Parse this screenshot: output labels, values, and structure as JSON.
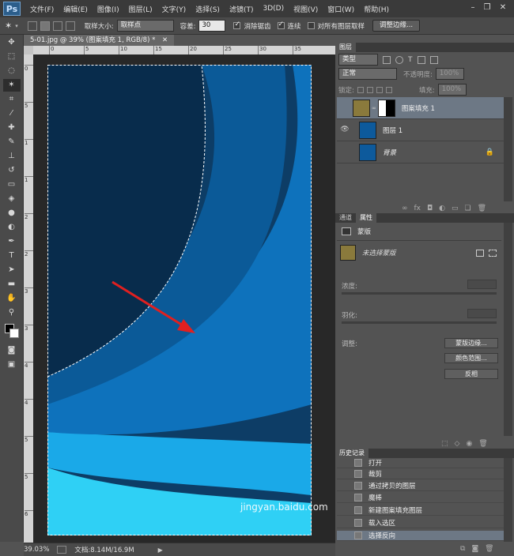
{
  "menubar": {
    "logo": "Ps",
    "items": [
      "文件(F)",
      "编辑(E)",
      "图像(I)",
      "图层(L)",
      "文字(Y)",
      "选择(S)",
      "滤镜(T)",
      "3D(D)",
      "视图(V)",
      "窗口(W)",
      "帮助(H)"
    ]
  },
  "options": {
    "sample_size_label": "取样大小:",
    "sample_size_value": "取样点",
    "tolerance_label": "容差:",
    "tolerance_value": "30",
    "antialias_label": "消除锯齿",
    "contiguous_label": "连续",
    "all_layers_label": "对所有图层取样",
    "refine_edge_button": "调整边缘..."
  },
  "document": {
    "tab_title": "5-01.jpg @ 39% (图案填充 1, RGB/8) *",
    "zoom": "39.03%",
    "doc_size": "文档:8.14M/16.9M",
    "ruler_h_ticks": [
      "0",
      "5",
      "10",
      "15",
      "20",
      "25",
      "30",
      "35"
    ],
    "ruler_v_ticks": [
      "0",
      "5",
      "1",
      "1",
      "2",
      "2",
      "3",
      "3",
      "4",
      "4",
      "5",
      "5",
      "6"
    ]
  },
  "layers_panel": {
    "tab": "图层",
    "filter_label": "类型",
    "blend_mode": "正常",
    "opacity_label": "不透明度:",
    "opacity_value": "100%",
    "lock_label": "锁定:",
    "fill_label": "填充:",
    "fill_value": "100%",
    "layers": [
      {
        "name": "图案填充 1",
        "selected": true
      },
      {
        "name": "图层 1",
        "selected": false
      },
      {
        "name": "背景",
        "selected": false
      }
    ]
  },
  "properties_panel": {
    "tabs": [
      "通道",
      "属性"
    ],
    "section": "蒙版",
    "mask_status": "未选择蒙版",
    "density_label": "浓度:",
    "feather_label": "羽化:",
    "adjust_label": "调整:",
    "buttons": [
      "蒙版边缘...",
      "颜色范围...",
      "反相"
    ]
  },
  "history_panel": {
    "tab": "历史记录",
    "items": [
      "打开",
      "裁剪",
      "通过拷贝的图层",
      "魔棒",
      "新建图案填充图层",
      "载入选区",
      "选择反向"
    ]
  },
  "watermark": "jingyan.baidu.com",
  "colors": {
    "accent": "#e02020",
    "selected_row": "#6d7885"
  }
}
